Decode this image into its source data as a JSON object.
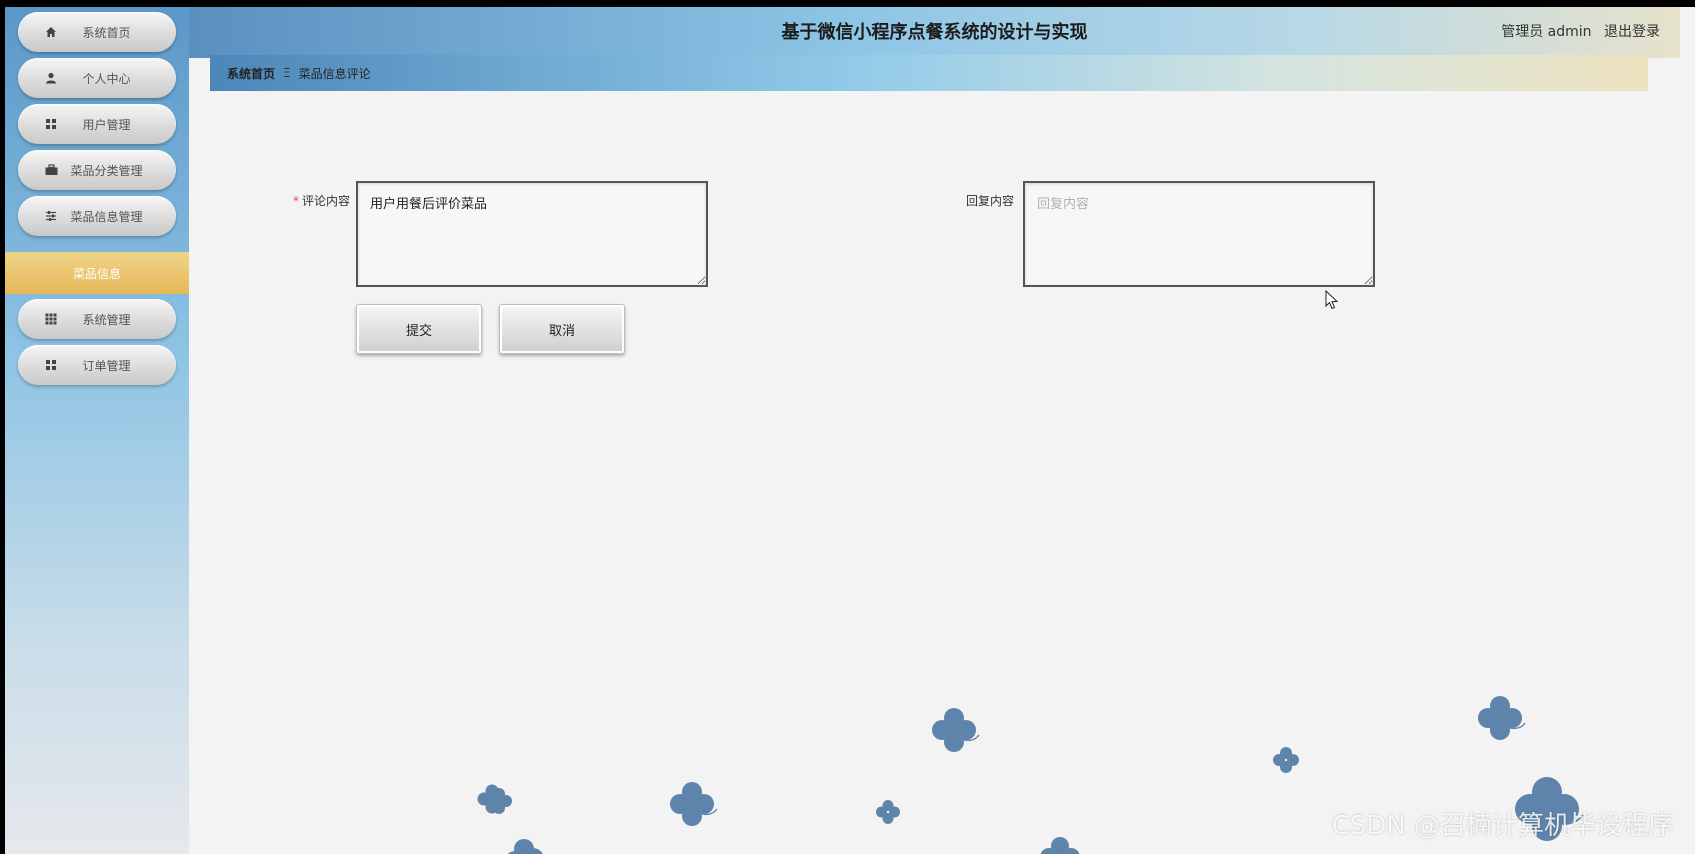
{
  "header": {
    "title": "基于微信小程序点餐系统的设计与实现",
    "role": "管理员 admin",
    "logout": "退出登录"
  },
  "sidebar": {
    "items": [
      {
        "label": "系统首页",
        "icon": "home-icon"
      },
      {
        "label": "个人中心",
        "icon": "user-icon"
      },
      {
        "label": "用户管理",
        "icon": "grid-icon"
      },
      {
        "label": "菜品分类管理",
        "icon": "briefcase-icon"
      },
      {
        "label": "菜品信息管理",
        "icon": "sliders-icon"
      }
    ],
    "active_label": "菜品信息",
    "items_after": [
      {
        "label": "系统管理",
        "icon": "grid9-icon"
      },
      {
        "label": "订单管理",
        "icon": "grid-icon"
      }
    ]
  },
  "breadcrumb": {
    "home": "系统首页",
    "separator": "Ξ",
    "current": "菜品信息评论"
  },
  "form": {
    "comment": {
      "required_mark": "*",
      "label": "评论内容",
      "value": "用户用餐后评价菜品"
    },
    "reply": {
      "label": "回复内容",
      "placeholder": "回复内容",
      "value": ""
    },
    "submit_label": "提交",
    "cancel_label": "取消"
  },
  "watermark": "CSDN @召楠计算机毕设程序",
  "colors": {
    "active_nav": "#e6b858",
    "flower": "#5f84ab",
    "background": "#f3f3f3"
  }
}
